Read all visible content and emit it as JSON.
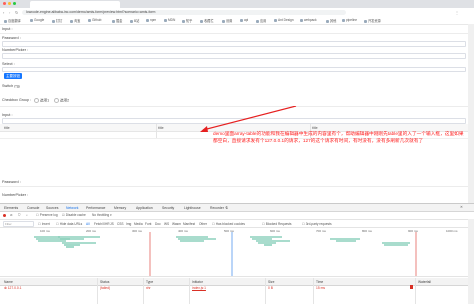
{
  "browser": {
    "url": "lowcode-engine.alibaba-inc.com/demo/amis-form/preview.html?scenario=amis-form",
    "bookmarks": [
      "百度翻译",
      "Google",
      "钉钉",
      "淘宝",
      "Github",
      "掘金",
      "B站",
      "npm",
      "MDN",
      "知乎",
      "收藏栏",
      "设置",
      "api",
      "应用",
      "Ant Design",
      "webpack",
      "其他",
      "pipeline",
      "开发资源"
    ]
  },
  "form": {
    "input_label": "Input :",
    "password_label": "Password :",
    "number_label": "NumberPicker :",
    "select_label": "Select :",
    "primary_button": "主要按钮",
    "switch_label": "Switch :",
    "checkbox_group_label": "Checkbox Group :",
    "option_1": "选项1",
    "option_2": "选项2",
    "input2_label": "Input :",
    "table_headers": [
      "title",
      "title",
      "title"
    ],
    "password2_label": "Password :",
    "number2_label": "NumberPicker :"
  },
  "annotation": "demo里面array-table的功能和我在编辑器中生成的内容里有个，帮助编辑器中刚刚先table里的入了一个输入框，这里如果都空白，直接请求发有个127.0.0.1的请求，127的这个请求有时间，有时没有，没有多刷新几次就有了",
  "devtools": {
    "tabs": [
      "Elements",
      "Console",
      "Sources",
      "Network",
      "Performance",
      "Memory",
      "Application",
      "Security",
      "Lighthouse",
      "Recorder ⚗"
    ],
    "active_tab": "Network",
    "toolbar": [
      "Preserve log",
      "Disable cache",
      "No throttling"
    ],
    "filter_placeholder": "Filter",
    "filter_options": [
      "Invert",
      "Hide data URLs",
      "All",
      "Fetch/XHR",
      "JS",
      "CSS",
      "Img",
      "Media",
      "Font",
      "Doc",
      "WS",
      "Wasm",
      "Manifest",
      "Other",
      "Has blocked cookies",
      "Blocked Requests",
      "3rd-party requests"
    ],
    "ticks": [
      "100 ms",
      "200 ms",
      "300 ms",
      "400 ms",
      "500 ms",
      "600 ms",
      "700 ms",
      "800 ms",
      "900 ms",
      "1000 ms"
    ],
    "columns": [
      "Name",
      "Status",
      "Type",
      "Initiator",
      "Size",
      "Time",
      "Waterfall"
    ],
    "row": {
      "name": "127.0.0.1",
      "status": "(failed)",
      "type": "xhr",
      "initiator": "index.js:1",
      "size": "0 B",
      "time": "15 ms"
    }
  }
}
